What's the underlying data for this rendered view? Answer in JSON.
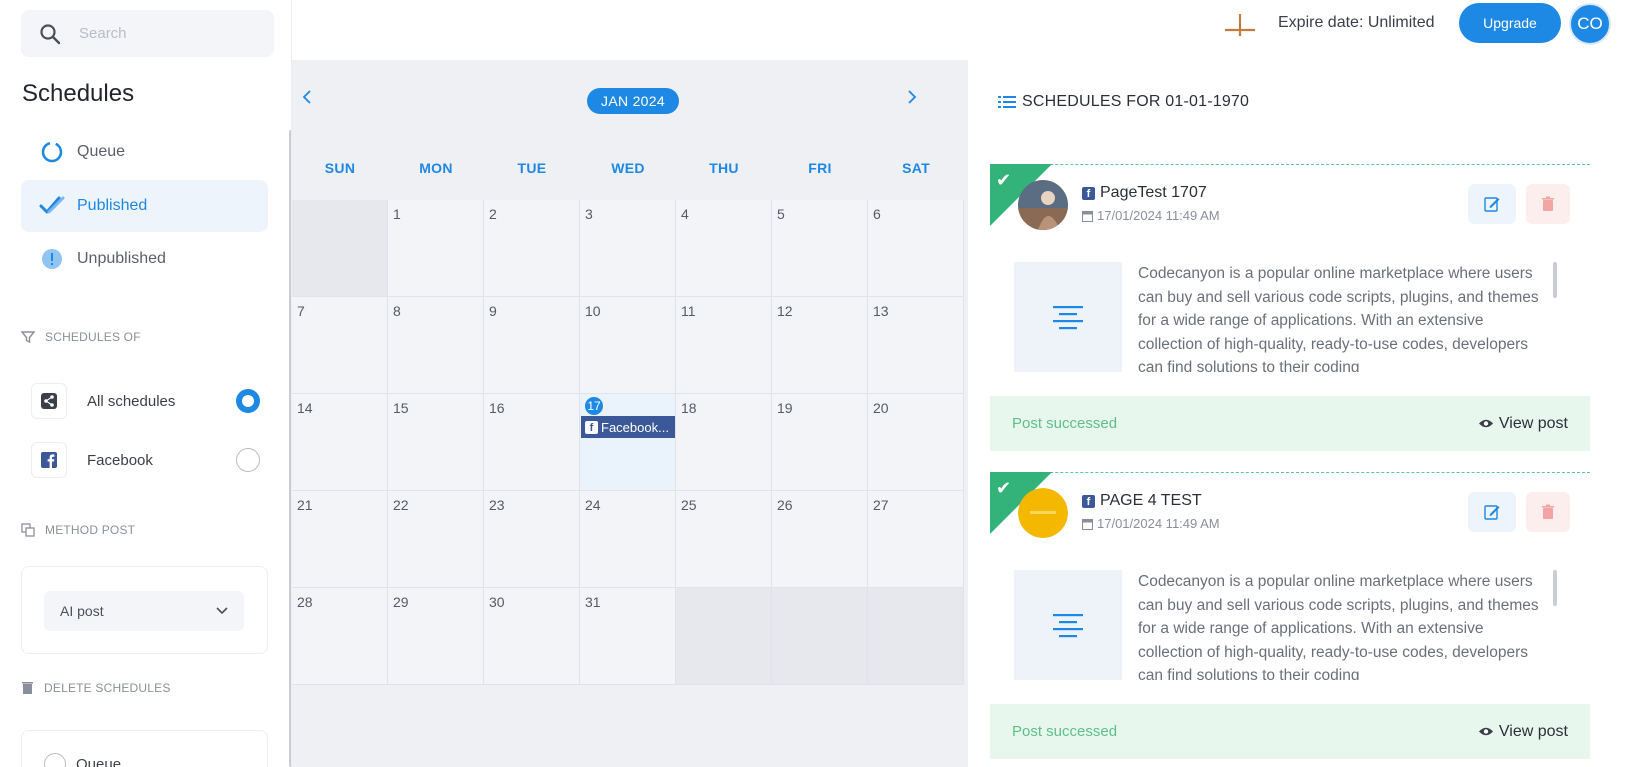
{
  "search": {
    "placeholder": "Search"
  },
  "sidebar": {
    "title": "Schedules",
    "nav": [
      {
        "label": "Queue"
      },
      {
        "label": "Published"
      },
      {
        "label": "Unpublished"
      }
    ],
    "schedules_of_label": "SCHEDULES OF",
    "filters": [
      {
        "label": "All schedules",
        "selected": true
      },
      {
        "label": "Facebook",
        "selected": false
      }
    ],
    "method_label": "METHOD POST",
    "method_value": "AI post",
    "delete_label": "DELETE SCHEDULES",
    "delete_option": "Queue"
  },
  "topbar": {
    "expire": "Expire date: Unlimited",
    "upgrade": "Upgrade",
    "avatar_initials": "CO"
  },
  "calendar": {
    "month": "JAN 2024",
    "days_of_week": [
      "SUN",
      "MON",
      "TUE",
      "WED",
      "THU",
      "FRI",
      "SAT"
    ],
    "days": [
      "1",
      "2",
      "3",
      "4",
      "5",
      "6",
      "7",
      "8",
      "9",
      "10",
      "11",
      "12",
      "13",
      "14",
      "15",
      "16",
      "17",
      "18",
      "19",
      "20",
      "21",
      "22",
      "23",
      "24",
      "25",
      "26",
      "27",
      "28",
      "29",
      "30",
      "31"
    ],
    "event": {
      "day": "17",
      "label": "Facebook..."
    }
  },
  "panel": {
    "title": "SCHEDULES FOR 01-01-1970",
    "posts": [
      {
        "page": "PageTest 1707",
        "date": "17/01/2024 11:49 AM",
        "content": "Codecanyon is a popular online marketplace where users can buy and sell various code scripts, plugins, and themes for a wide range of applications. With an extensive collection of high-quality, ready-to-use codes, developers can find solutions to their coding",
        "status": "Post successed",
        "view": "View post"
      },
      {
        "page": "PAGE 4 TEST",
        "date": "17/01/2024 11:49 AM",
        "content": "Codecanyon is a popular online marketplace where users can buy and sell various code scripts, plugins, and themes for a wide range of applications. With an extensive collection of high-quality, ready-to-use codes, developers can find solutions to their coding",
        "status": "Post successed",
        "view": "View post"
      }
    ]
  },
  "colors": {
    "accent": "#1e88e5",
    "facebook": "#3b5998",
    "success": "#33b27a"
  }
}
